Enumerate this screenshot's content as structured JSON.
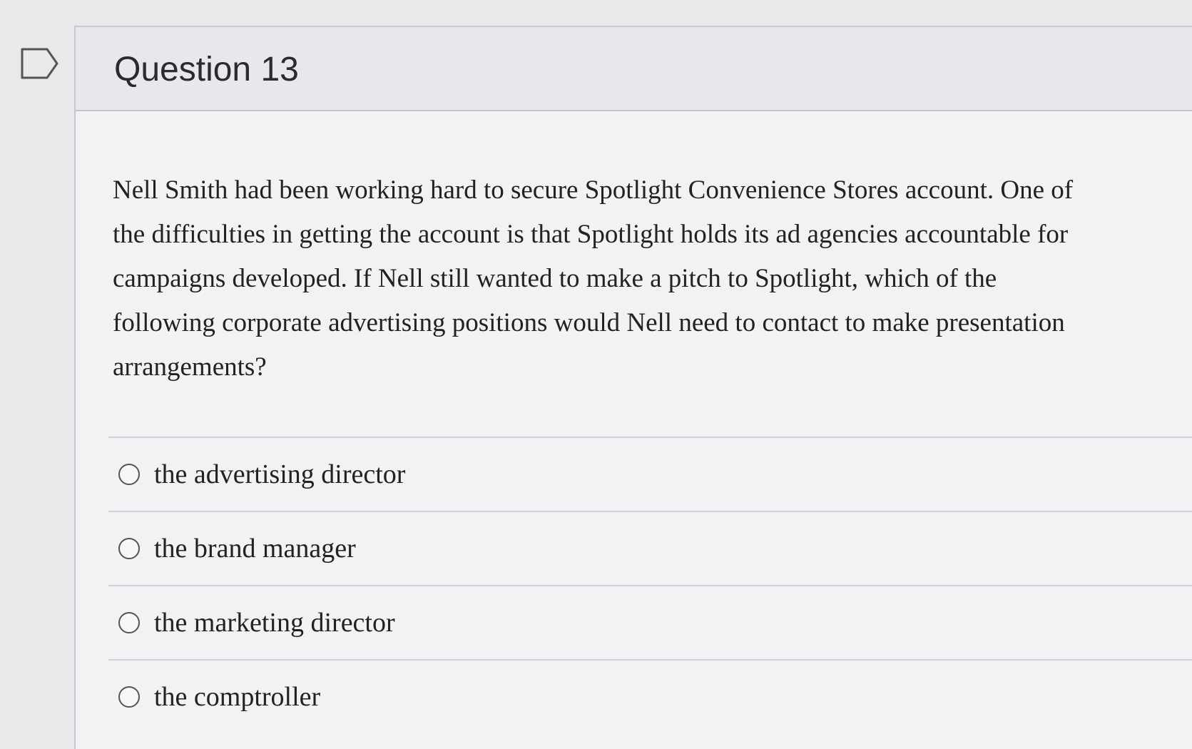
{
  "question": {
    "title": "Question 13",
    "text": "Nell Smith had been working hard to secure Spotlight Convenience Stores account. One of the difficulties in getting the account is that Spotlight holds its ad agencies accountable for campaigns developed. If Nell still wanted to make a pitch to Spotlight, which of the following corporate advertising positions would Nell need to contact to make presentation arrangements?",
    "flag_icon": "bookmark-flag-icon"
  },
  "answers": [
    {
      "label": "the advertising director"
    },
    {
      "label": "the brand manager"
    },
    {
      "label": "the marketing director"
    },
    {
      "label": "the comptroller"
    }
  ],
  "colors": {
    "background": "#e9e9ec",
    "header": "#e8e8ec",
    "text": "#222222"
  }
}
